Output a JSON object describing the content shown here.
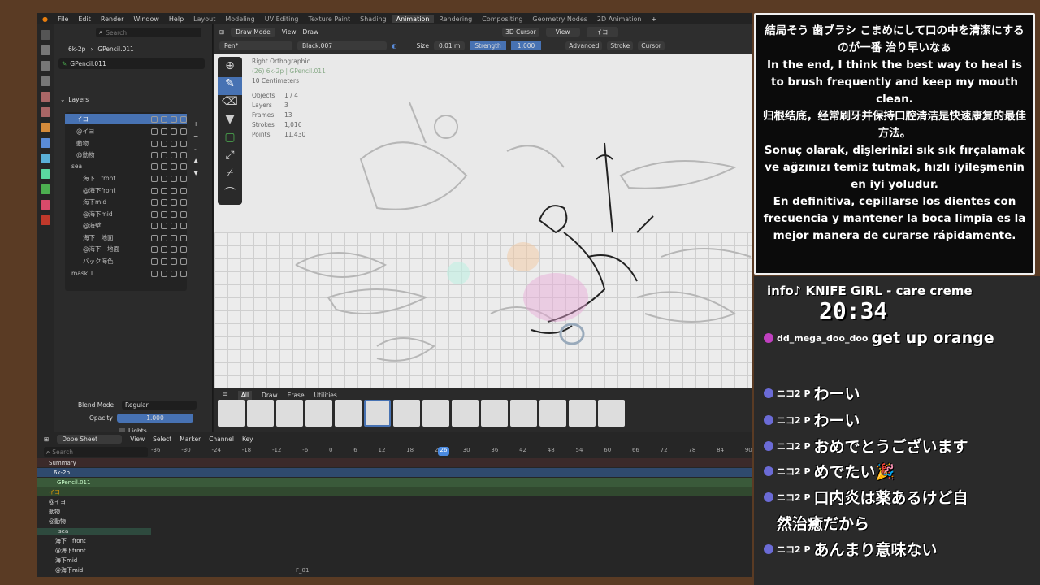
{
  "topbar": {
    "menus": [
      "File",
      "Edit",
      "Render",
      "Window",
      "Help"
    ],
    "workspaces": [
      "Layout",
      "Modeling",
      "UV Editing",
      "Texture Paint",
      "Shading",
      "Animation",
      "Rendering",
      "Compositing",
      "Geometry Nodes",
      "2D Animation"
    ],
    "active_workspace": "Animation"
  },
  "props": {
    "search_placeholder": "Search",
    "obj_name": "6k-2p",
    "data_name": "GPencil.011",
    "gp_name": "GPencil.011",
    "layers_title": "Layers",
    "layers": [
      "イヨ",
      "@イヨ",
      "動物",
      "@動物",
      "sea",
      "海下　front",
      "@海下front",
      "海下mid",
      "@海下mid",
      "@海壁",
      "海下　地面",
      "@海下　地面",
      "バック海色",
      "mask 1"
    ],
    "blend_label": "Blend Mode",
    "blend_value": "Regular",
    "opacity_label": "Opacity",
    "opacity_value": "1.000",
    "lights_label": "Lights"
  },
  "viewport": {
    "mode": "Draw Mode",
    "view": "View",
    "draw": "Draw",
    "brush": "Pen*",
    "material": "Black.007",
    "size_label": "Size",
    "size_value": "0.01 m",
    "strength_label": "Strength",
    "strength_value": "1.000",
    "cursor": "3D Cursor",
    "view2": "View",
    "layer_sel": "イヨ",
    "advanced": "Advanced",
    "stroke": "Stroke",
    "cursor2": "Cursor",
    "overlay_lines": [
      "Right Orthographic",
      "(26) 6k-2p | GPencil.011",
      "10 Centimeters"
    ],
    "stats_labels": [
      "Objects",
      "Layers",
      "Frames",
      "Strokes",
      "Points"
    ],
    "stats_values": [
      "1 / 4",
      "3",
      "13",
      "1,016",
      "11,430"
    ]
  },
  "brushbar": {
    "tabs": [
      "All",
      "Draw",
      "Erase",
      "Utilities"
    ],
    "active_tab": "All"
  },
  "dopesheet": {
    "mode": "Dope Sheet",
    "menus": [
      "View",
      "Select",
      "Marker",
      "Channel",
      "Key"
    ],
    "search_placeholder": "Search",
    "frame_ticks": [
      "-36",
      "-30",
      "-24",
      "-18",
      "-12",
      "-6",
      "0",
      "6",
      "12",
      "18",
      "24",
      "30",
      "36",
      "42",
      "48",
      "54",
      "60",
      "66",
      "72",
      "78",
      "84",
      "90"
    ],
    "current_frame": "26",
    "channels": [
      "Summary",
      "6k-2p",
      "GPencil.011",
      "イヨ",
      "@イヨ",
      "動物",
      "@動物",
      "sea",
      "海下　front",
      "@海下front",
      "海下mid",
      "@海下mid"
    ],
    "marker": "F_01"
  },
  "overlay": {
    "lines": [
      "結局そう 歯ブラシ こまめにして口の中を清潔にするのが一番 治り早いなぁ",
      "In the end, I think the best way to heal is to brush frequently and keep my mouth clean.",
      "归根结底，经常刷牙并保持口腔清洁是快速康复的最佳方法。",
      "Sonuç olarak, dişlerinizi sık sık fırçalamak ve ağzınızı temiz tutmak, hızlı iyileşmenin en iyi yoludur.",
      "En definitiva, cepillarse los dientes con frecuencia y mantener la boca limpia es la mejor manera de curarse rápidamente."
    ]
  },
  "stream": {
    "music": "info♪  KNIFE GIRL - care creme",
    "clock": "20:34",
    "chat": [
      {
        "user": "dd_mega_doo_doo",
        "msg": "get up orange"
      },
      {
        "user": "ニコ2 P",
        "msg": "わーい"
      },
      {
        "user": "ニコ2 P",
        "msg": "わーい"
      },
      {
        "user": "ニコ2 P",
        "msg": "おめでとうございます"
      },
      {
        "user": "ニコ2 P",
        "msg": "めでたい🎉"
      },
      {
        "user": "ニコ2 P",
        "msg": "口内炎は薬あるけど自"
      },
      {
        "user": "",
        "msg": "然治癒だから"
      },
      {
        "user": "ニコ2 P",
        "msg": "あんまり意味ない"
      }
    ]
  }
}
